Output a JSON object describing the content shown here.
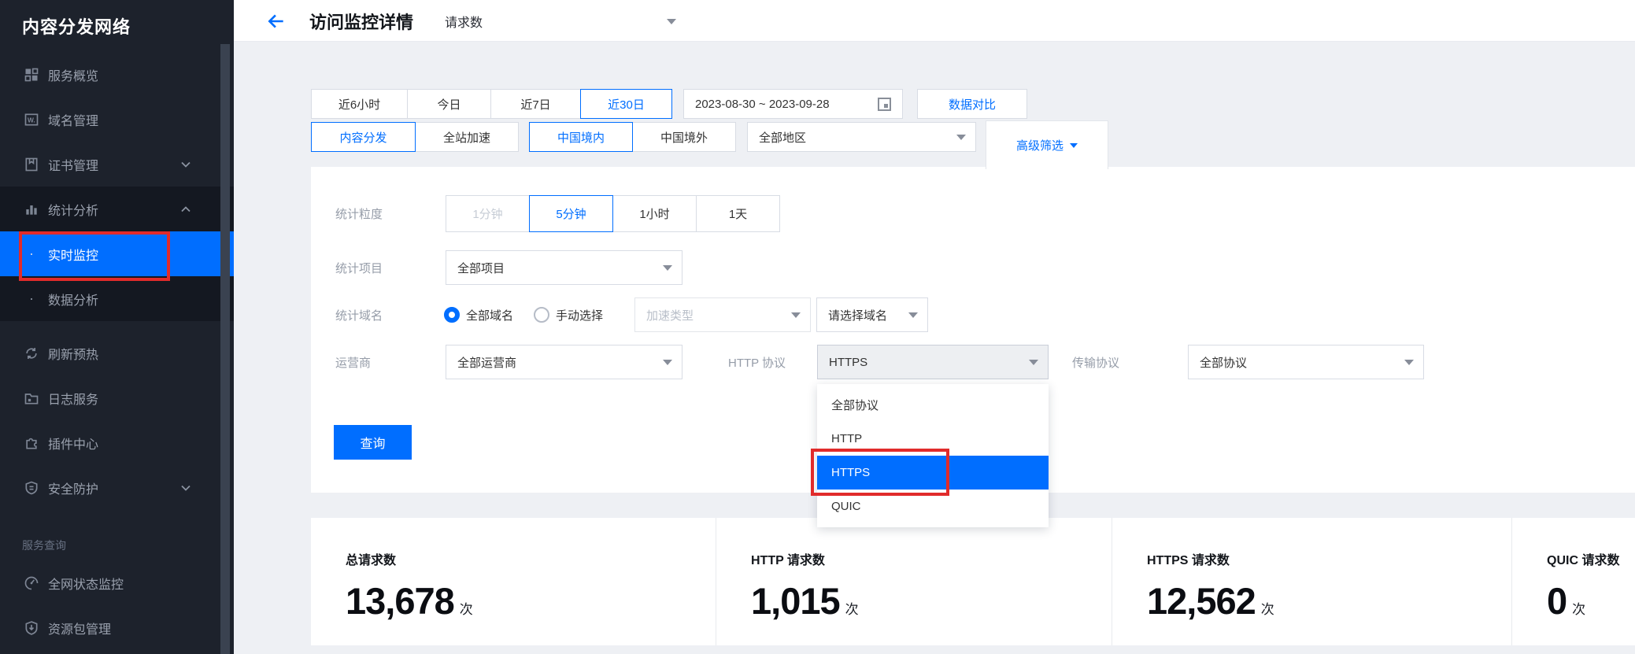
{
  "colors": {
    "accent": "#006eff",
    "annotation_red": "#e12b2b",
    "sidebar_bg": "#1d222c",
    "active_bg": "#006eff"
  },
  "sidebar": {
    "title": "内容分发网络",
    "items": [
      {
        "label": "服务概览",
        "icon": "grid-icon"
      },
      {
        "label": "域名管理",
        "icon": "domain-icon"
      },
      {
        "label": "证书管理",
        "icon": "bookmark-icon",
        "chevron": "down"
      },
      {
        "label": "统计分析",
        "icon": "bar-chart-icon",
        "chevron": "up"
      },
      {
        "label": "实时监控",
        "bullet": "·",
        "active": true
      },
      {
        "label": "数据分析",
        "bullet": "·"
      },
      {
        "label": "刷新预热",
        "icon": "refresh-icon"
      },
      {
        "label": "日志服务",
        "icon": "folder-icon"
      },
      {
        "label": "插件中心",
        "icon": "puzzle-icon"
      },
      {
        "label": "安全防护",
        "icon": "shield-icon",
        "chevron": "down"
      },
      {
        "label": "全网状态监控",
        "icon": "gauge-icon"
      },
      {
        "label": "资源包管理",
        "icon": "package-icon"
      }
    ],
    "section_label": "服务查询"
  },
  "header": {
    "title": "访问监控详情",
    "metric_select": "请求数"
  },
  "filters": {
    "time_ranges": [
      {
        "label": "近6小时"
      },
      {
        "label": "今日"
      },
      {
        "label": "近7日"
      },
      {
        "label": "近30日",
        "selected": true
      }
    ],
    "date_range": "2023-08-30  ~ 2023-09-28",
    "compare_label": "数据对比",
    "product_tabs": [
      {
        "label": "内容分发",
        "selected": true
      },
      {
        "label": "全站加速"
      }
    ],
    "region_tabs": [
      {
        "label": "中国境内",
        "selected": true
      },
      {
        "label": "中国境外"
      }
    ],
    "area_select": "全部地区",
    "advanced_label": "高级筛选"
  },
  "form": {
    "granularity": {
      "label": "统计粒度",
      "options": [
        {
          "label": "1分钟",
          "disabled": true
        },
        {
          "label": "5分钟",
          "selected": true
        },
        {
          "label": "1小时"
        },
        {
          "label": "1天"
        }
      ]
    },
    "project": {
      "label": "统计项目",
      "value": "全部项目"
    },
    "domain": {
      "label": "统计域名",
      "radio_all": "全部域名",
      "radio_manual": "手动选择",
      "type_placeholder": "加速类型",
      "domain_placeholder": "请选择域名"
    },
    "isp": {
      "label": "运营商",
      "value": "全部运营商"
    },
    "http_protocol": {
      "label": "HTTP 协议",
      "value": "HTTPS",
      "options": [
        {
          "label": "全部协议"
        },
        {
          "label": "HTTP"
        },
        {
          "label": "HTTPS",
          "selected": true
        },
        {
          "label": "QUIC"
        }
      ]
    },
    "transport": {
      "label": "传输协议",
      "value": "全部协议"
    },
    "query_label": "查询"
  },
  "stats": [
    {
      "label": "总请求数",
      "value": "13,678",
      "unit": "次"
    },
    {
      "label": "HTTP 请求数",
      "value": "1,015",
      "unit": "次"
    },
    {
      "label": "HTTPS 请求数",
      "value": "12,562",
      "unit": "次"
    },
    {
      "label": "QUIC 请求数",
      "value": "0",
      "unit": "次"
    }
  ]
}
